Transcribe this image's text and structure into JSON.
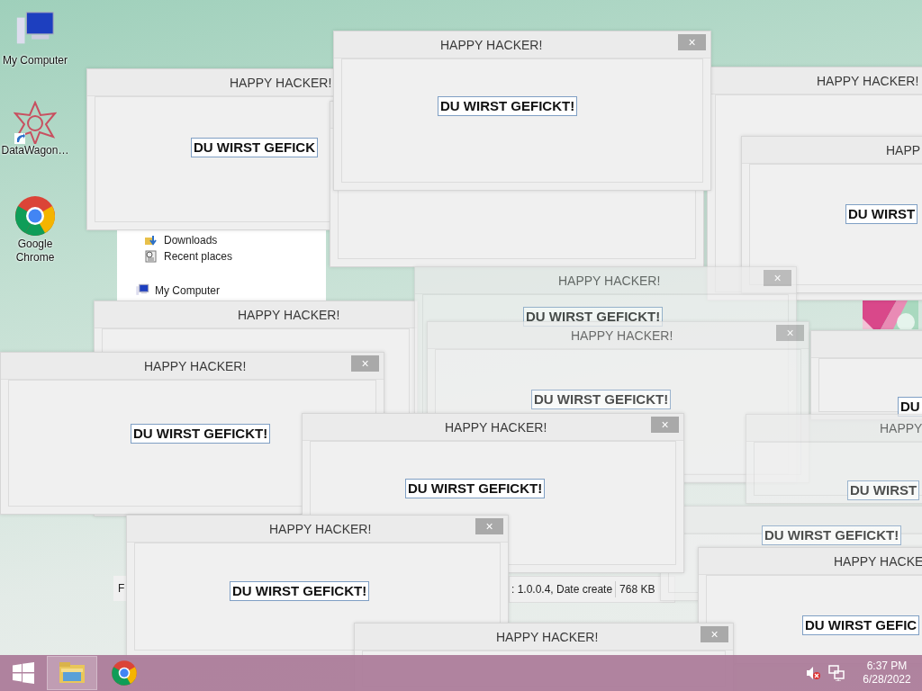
{
  "desktop_icons": [
    {
      "label": "My Computer",
      "kind": "computer"
    },
    {
      "label": "DataWagon…",
      "kind": "star"
    },
    {
      "label": "Google Chrome",
      "kind": "chrome"
    }
  ],
  "explorer": {
    "sidebar": [
      {
        "label": "Downloads",
        "kind": "downloads"
      },
      {
        "label": "Recent places",
        "kind": "recent"
      },
      {
        "label": "My Computer",
        "kind": "computer"
      }
    ],
    "status_left": "F",
    "status_details": ": 1.0.0.4, Date create",
    "status_size": "768 KB"
  },
  "windows": [
    {
      "title": "HAPPY HACKER!",
      "message": "DU WIRST GEFICK",
      "faded": false
    },
    {
      "faded": false
    },
    {
      "title": "HAPPY HACKER!",
      "faded": false
    },
    {
      "title": "HAPP",
      "message": "DU WIRST",
      "faded": false
    },
    {
      "title": "HAPPY HACKER!",
      "message": "DU WIRST GEFICKT!",
      "close": "×",
      "faded": false
    },
    {
      "title": "HAPPY HACKER!",
      "faded": false
    },
    {
      "title": "HAPPY HACKER!",
      "message": "DU WIRST GEFICKT!",
      "close": "×",
      "faded": true
    },
    {
      "title": "HAPPY HACKER!",
      "message": "DU WIRST GEFICKT!",
      "close": "×",
      "faded": true
    },
    {
      "message": "DU",
      "faded": false
    },
    {
      "title": "HAPPY",
      "message": "DU WIRST",
      "faded": true
    },
    {
      "message": "DU WIRST GEFICKT!",
      "faded": true
    },
    {
      "title": "HAPPY HACKE",
      "message": "DU WIRST GEFIC",
      "faded": false
    },
    {
      "title": "HAPPY HACKER!",
      "message": "DU WIRST GEFICKT!",
      "close": "×",
      "faded": false
    },
    {
      "title": "HAPPY HACKER!",
      "message": "DU WIRST GEFICKT!",
      "close": "×",
      "faded": false
    },
    {
      "title": "HAPPY HACKER!",
      "message": "DU WIRST GEFICKT!",
      "close": "×",
      "faded": false
    },
    {
      "title": "HAPPY HACKER!",
      "close": "×",
      "faded": false
    }
  ],
  "taskbar": {
    "apps": [
      {
        "kind": "explorer",
        "selected": true
      },
      {
        "kind": "chrome",
        "selected": false
      }
    ],
    "time": "6:37 PM",
    "date": "6/28/2022"
  }
}
